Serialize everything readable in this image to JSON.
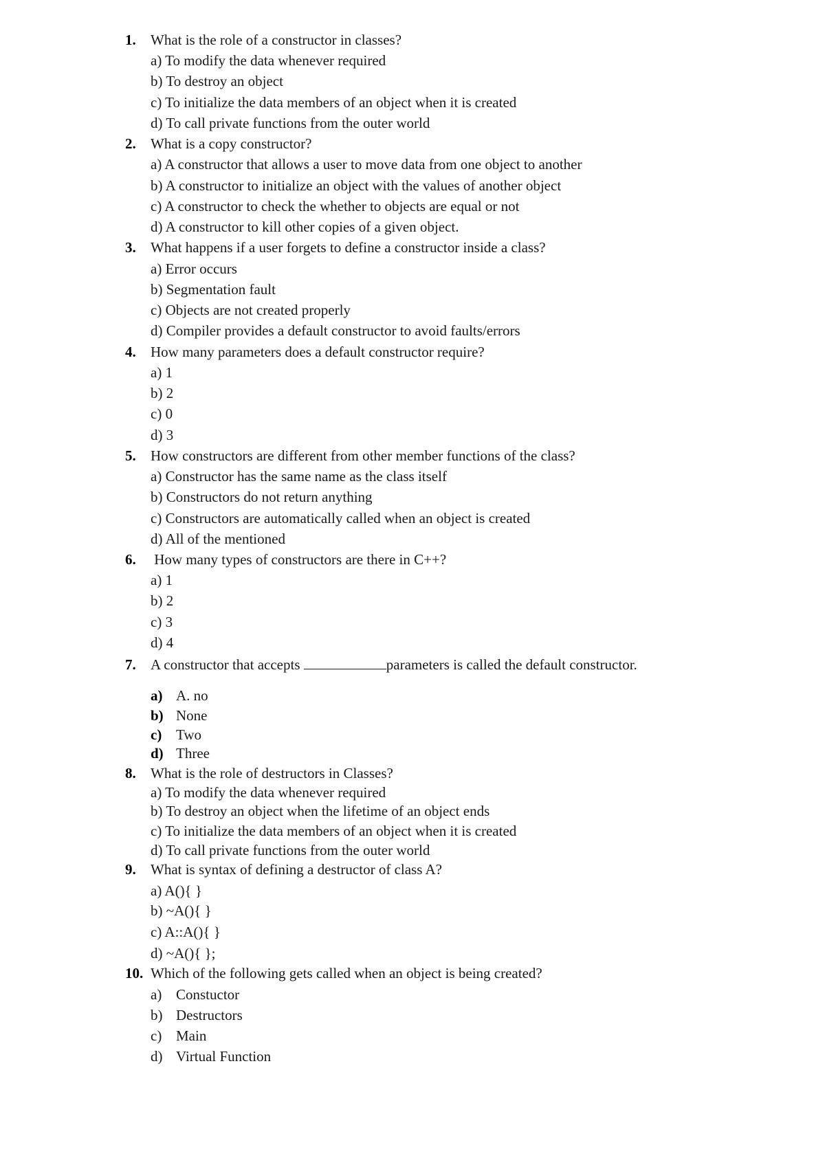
{
  "questions": [
    {
      "number": "1.",
      "text": "What is the role of a constructor in classes?",
      "options": [
        "a) To modify the data whenever required",
        "b) To destroy an object",
        "c) To initialize the data members of an object when it is created",
        "d) To call private functions from the outer world"
      ]
    },
    {
      "number": "2.",
      "text": "What is a copy constructor?",
      "options": [
        "a) A constructor that allows a user to move data from one object to another",
        "b) A constructor to initialize an object with the values of another object",
        "c) A constructor to check the whether to objects are equal or not",
        "d) A constructor to kill other copies of a given object."
      ]
    },
    {
      "number": "3.",
      "text": "What happens if a user forgets to define a constructor inside a class?",
      "options": [
        "a) Error occurs",
        "b) Segmentation fault",
        "c) Objects are not created properly",
        "d) Compiler provides a default constructor to avoid faults/errors"
      ]
    },
    {
      "number": "4.",
      "text": "How many parameters does a default constructor require?",
      "options": [
        "a) 1",
        "b) 2",
        "c) 0",
        "d) 3"
      ]
    },
    {
      "number": "5.",
      "text": "How constructors are different from other member functions of the class?",
      "options": [
        "a) Constructor has the same name as the class itself",
        "b) Constructors do not return anything",
        "c) Constructors are automatically called when an object is created",
        "d) All of the mentioned"
      ]
    },
    {
      "number": "6.",
      "text": " How many types of constructors are there in C++?",
      "options": [
        "a) 1",
        "b) 2",
        "c) 3",
        "d) 4"
      ]
    },
    {
      "number": "7.",
      "text_before": "A constructor that accepts ",
      "text_after": "parameters is called the default constructor.",
      "labeled_options": [
        {
          "label": "a)",
          "text": "A. no"
        },
        {
          "label": "b)",
          "text": "None"
        },
        {
          "label": "c)",
          "text": "Two"
        },
        {
          "label": "d)",
          "text": "Three"
        }
      ]
    },
    {
      "number": "8.",
      "text": "What is the role of destructors in Classes?",
      "options": [
        "a) To modify the data whenever required",
        "b) To destroy an object when the lifetime of an object ends",
        "c) To initialize the data members of an object when it is created",
        "d) To call private functions from the outer world"
      ]
    },
    {
      "number": "9.",
      "text": "What is syntax of defining a destructor of class A?",
      "options": [
        "a) A(){ }",
        "b) ~A(){ }",
        "c) A::A(){ }",
        "d) ~A(){ };"
      ]
    },
    {
      "number": "10.",
      "text": "Which of the following gets called when an object is being created?",
      "labeled_options": [
        {
          "label": "a)",
          "text": "Constuctor"
        },
        {
          "label": "b)",
          "text": "Destructors"
        },
        {
          "label": "c)",
          "text": "Main"
        },
        {
          "label": "d)",
          "text": "Virtual Function"
        }
      ],
      "plain_labels": true
    }
  ]
}
